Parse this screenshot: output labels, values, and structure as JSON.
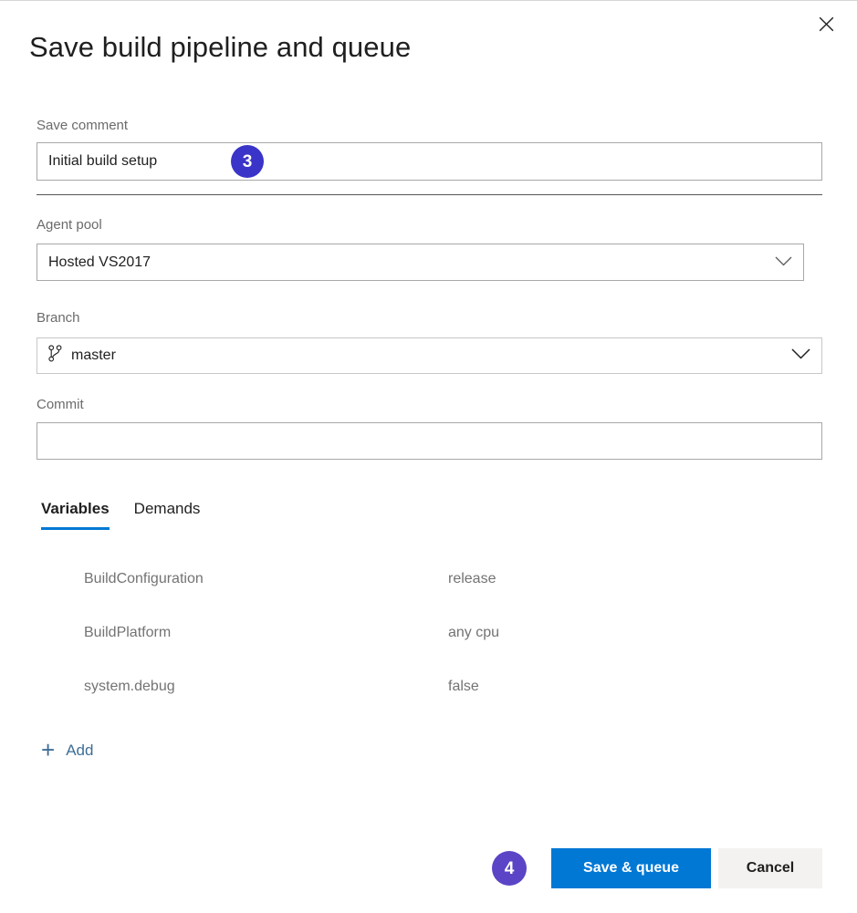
{
  "dialog": {
    "title": "Save build pipeline and queue",
    "close_icon": "close-icon"
  },
  "form": {
    "save_comment": {
      "label": "Save comment",
      "value": "Initial build setup",
      "placeholder": ""
    },
    "agent_pool": {
      "label": "Agent pool",
      "value": "Hosted VS2017",
      "chevron_icon": "chevron-down-icon"
    },
    "branch": {
      "label": "Branch",
      "value": "master",
      "branch_icon": "git-branch-icon",
      "chevron_icon": "chevron-down-icon"
    },
    "commit": {
      "label": "Commit",
      "value": "",
      "placeholder": ""
    }
  },
  "badges": {
    "step_three": "3",
    "step_four": "4"
  },
  "tabs": [
    {
      "label": "Variables",
      "active": true
    },
    {
      "label": "Demands",
      "active": false
    }
  ],
  "variables": [
    {
      "name": "BuildConfiguration",
      "value": "release"
    },
    {
      "name": "BuildPlatform",
      "value": "any cpu"
    },
    {
      "name": "system.debug",
      "value": "false"
    }
  ],
  "add_link": {
    "plus": "+",
    "label": "Add",
    "icon": "plus-icon"
  },
  "footer": {
    "primary_label": "Save & queue",
    "secondary_label": "Cancel"
  },
  "colors": {
    "accent": "#0078d4",
    "badge_three": "#3a34c8",
    "badge_four": "#5b45c6",
    "link": "#3e6e96",
    "secondary_button_bg": "#f3f2f1"
  }
}
